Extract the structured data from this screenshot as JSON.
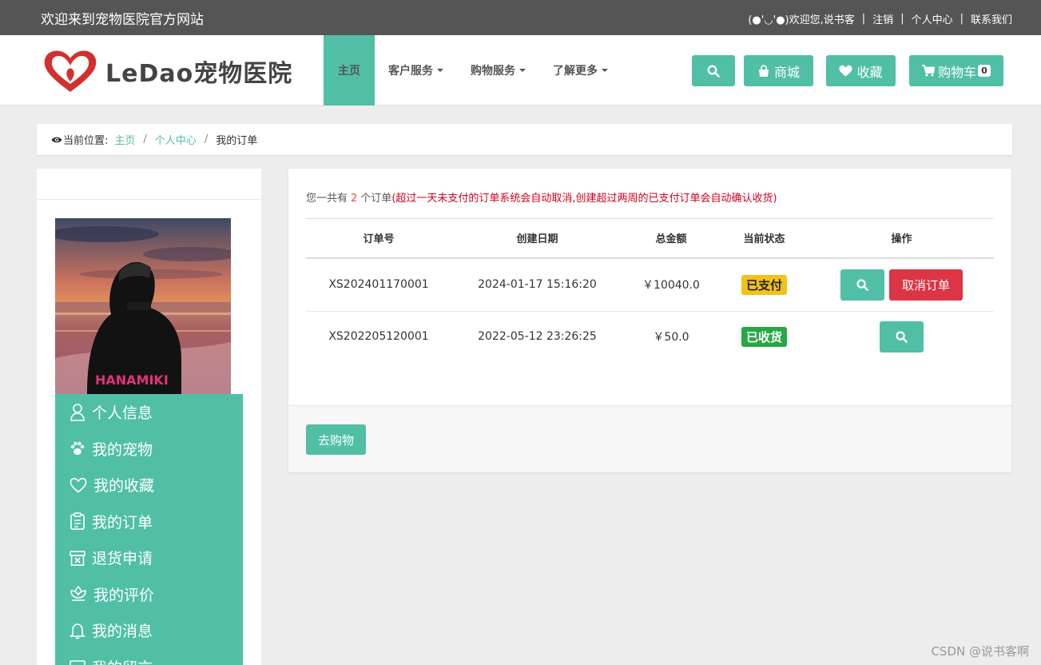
{
  "topbar": {
    "welcome": "欢迎来到宠物医院官方网站",
    "greeting": "(●'◡'●)欢迎您,说书客",
    "logout": "注销",
    "user_center": "个人中心",
    "contact": "联系我们"
  },
  "nav": {
    "logo_text": "LeDao宠物医院",
    "menu": [
      {
        "label": "主页"
      },
      {
        "label": "客户服务"
      },
      {
        "label": "购物服务"
      },
      {
        "label": "了解更多"
      }
    ],
    "mall_label": "商城",
    "favorites_label": "收藏",
    "cart_label": "购物车",
    "cart_count": "0"
  },
  "breadcrumb": {
    "prefix": "当前位置:",
    "home": "主页",
    "sep": "/",
    "user_center": "个人中心",
    "current": "我的订单"
  },
  "sidebar": {
    "items": [
      {
        "label": "个人信息",
        "icon": "user-icon"
      },
      {
        "label": "我的宠物",
        "icon": "paw-icon"
      },
      {
        "label": "我的收藏",
        "icon": "heart-icon"
      },
      {
        "label": "我的订单",
        "icon": "clipboard-icon"
      },
      {
        "label": "退货申请",
        "icon": "return-box-icon"
      },
      {
        "label": "我的评价",
        "icon": "flower-icon"
      },
      {
        "label": "我的消息",
        "icon": "bell-icon"
      },
      {
        "label": "我的留言",
        "icon": "message-icon"
      }
    ]
  },
  "orders": {
    "summary_prefix": "您一共有",
    "count": "2",
    "summary_suffix": "个订单",
    "note": "(超过一天未支付的订单系统会自动取消,创建超过两周的已支付订单会自动确认收货)",
    "headers": [
      "订单号",
      "创建日期",
      "总金额",
      "当前状态",
      "操作"
    ],
    "rows": [
      {
        "id": "XS202401170001",
        "date": "2024-01-17 15:16:20",
        "amount": "￥10040.0",
        "status": "已支付",
        "cancel_label": "取消订单"
      },
      {
        "id": "XS202205120001",
        "date": "2022-05-12 23:26:25",
        "amount": "￥50.0",
        "status": "已收货"
      }
    ],
    "go_shopping": "去购物"
  },
  "watermark": "CSDN @说书客啊",
  "colors": {
    "accent": "#50bfa6",
    "danger": "#dc3545",
    "paid": "#f3c117",
    "received": "#28a745"
  }
}
